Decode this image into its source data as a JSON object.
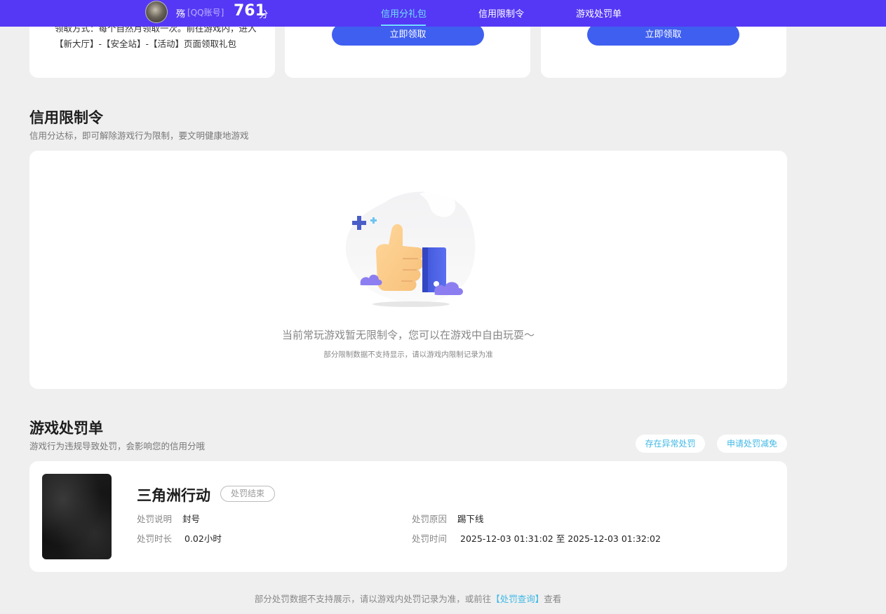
{
  "header": {
    "user_name": "殇",
    "account_type": "[QQ账号]",
    "score": "761",
    "score_unit": "分",
    "tabs": [
      {
        "label": "信用分礼包",
        "active": true
      },
      {
        "label": "信用限制令",
        "active": false
      },
      {
        "label": "游戏处罚单",
        "active": false
      }
    ],
    "colors": {
      "bar": "#5538f5",
      "active_tab": "#6fe0ff"
    }
  },
  "gift_cards": [
    {
      "desc": "领取方式：每个自然月领取一次。前往游戏内，进入【新大厅】-【安全站】-【活动】页面领取礼包"
    },
    {
      "button": "立即领取"
    },
    {
      "button": "立即领取"
    }
  ],
  "restriction": {
    "title": "信用限制令",
    "subtitle": "信用分达标，即可解除游戏行为限制，要文明健康地游戏",
    "illustration": "thumbs-up-icon",
    "empty_message": "当前常玩游戏暂无限制令，您可以在游戏中自由玩耍～",
    "empty_note": "部分限制数据不支持显示，请以游戏内限制记录为准"
  },
  "penalty": {
    "title": "游戏处罚单",
    "subtitle": "游戏行为违规导致处罚，会影响您的信用分哦",
    "actions": [
      "存在异常处罚",
      "申请处罚减免"
    ],
    "record": {
      "game": "三角洲行动",
      "status": "处罚结束",
      "desc_label": "处罚说明",
      "desc_value": "封号",
      "duration_label": "处罚时长",
      "duration_value": "0.02小时",
      "reason_label": "处罚原因",
      "reason_value": "踢下线",
      "time_label": "处罚时间",
      "time_value": "2025-12-03 01:31:02 至 2025-12-03 01:32:02"
    },
    "footer_text": "部分处罚数据不支持展示，请以游戏内处罚记录为准，或前往",
    "footer_link": "【处罚查询】",
    "footer_suffix": "查看"
  }
}
